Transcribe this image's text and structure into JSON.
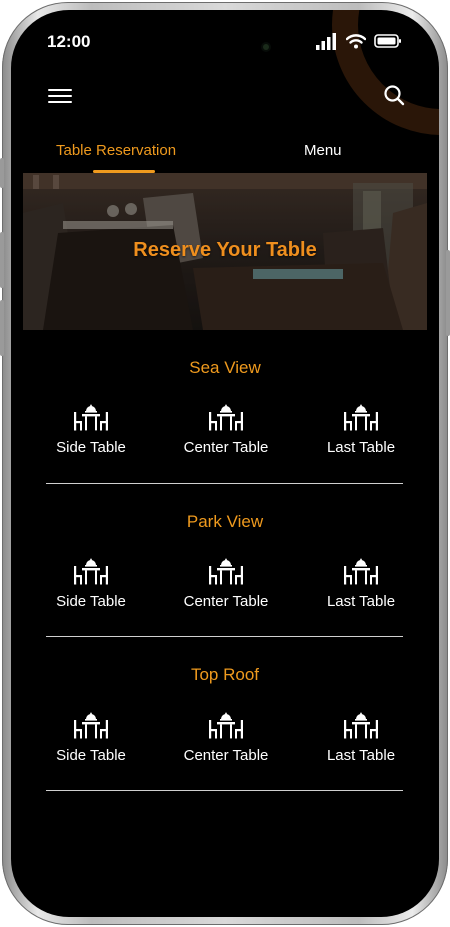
{
  "status_bar": {
    "time": "12:00"
  },
  "tabs": [
    {
      "label": "Table Reservation",
      "active": true
    },
    {
      "label": "Menu",
      "active": false
    }
  ],
  "hero": {
    "title": "Reserve Your Table"
  },
  "sections": [
    {
      "title": "Sea View",
      "tables": [
        {
          "label": "Side Table",
          "icon": "dining-table-icon"
        },
        {
          "label": "Center Table",
          "icon": "dining-table-icon"
        },
        {
          "label": "Last Table",
          "icon": "dining-table-icon"
        }
      ]
    },
    {
      "title": "Park View",
      "tables": [
        {
          "label": "Side Table",
          "icon": "dining-table-icon"
        },
        {
          "label": "Center Table",
          "icon": "dining-table-icon"
        },
        {
          "label": "Last Table",
          "icon": "dining-table-icon"
        }
      ]
    },
    {
      "title": "Top Roof",
      "tables": [
        {
          "label": "Side Table",
          "icon": "dining-table-icon"
        },
        {
          "label": "Center Table",
          "icon": "dining-table-icon"
        },
        {
          "label": "Last Table",
          "icon": "dining-table-icon"
        }
      ]
    }
  ],
  "colors": {
    "accent": "#ef9a1e",
    "background": "#000000",
    "text": "#ffffff"
  },
  "icons": {
    "menu": "hamburger-menu-icon",
    "search": "search-icon"
  }
}
